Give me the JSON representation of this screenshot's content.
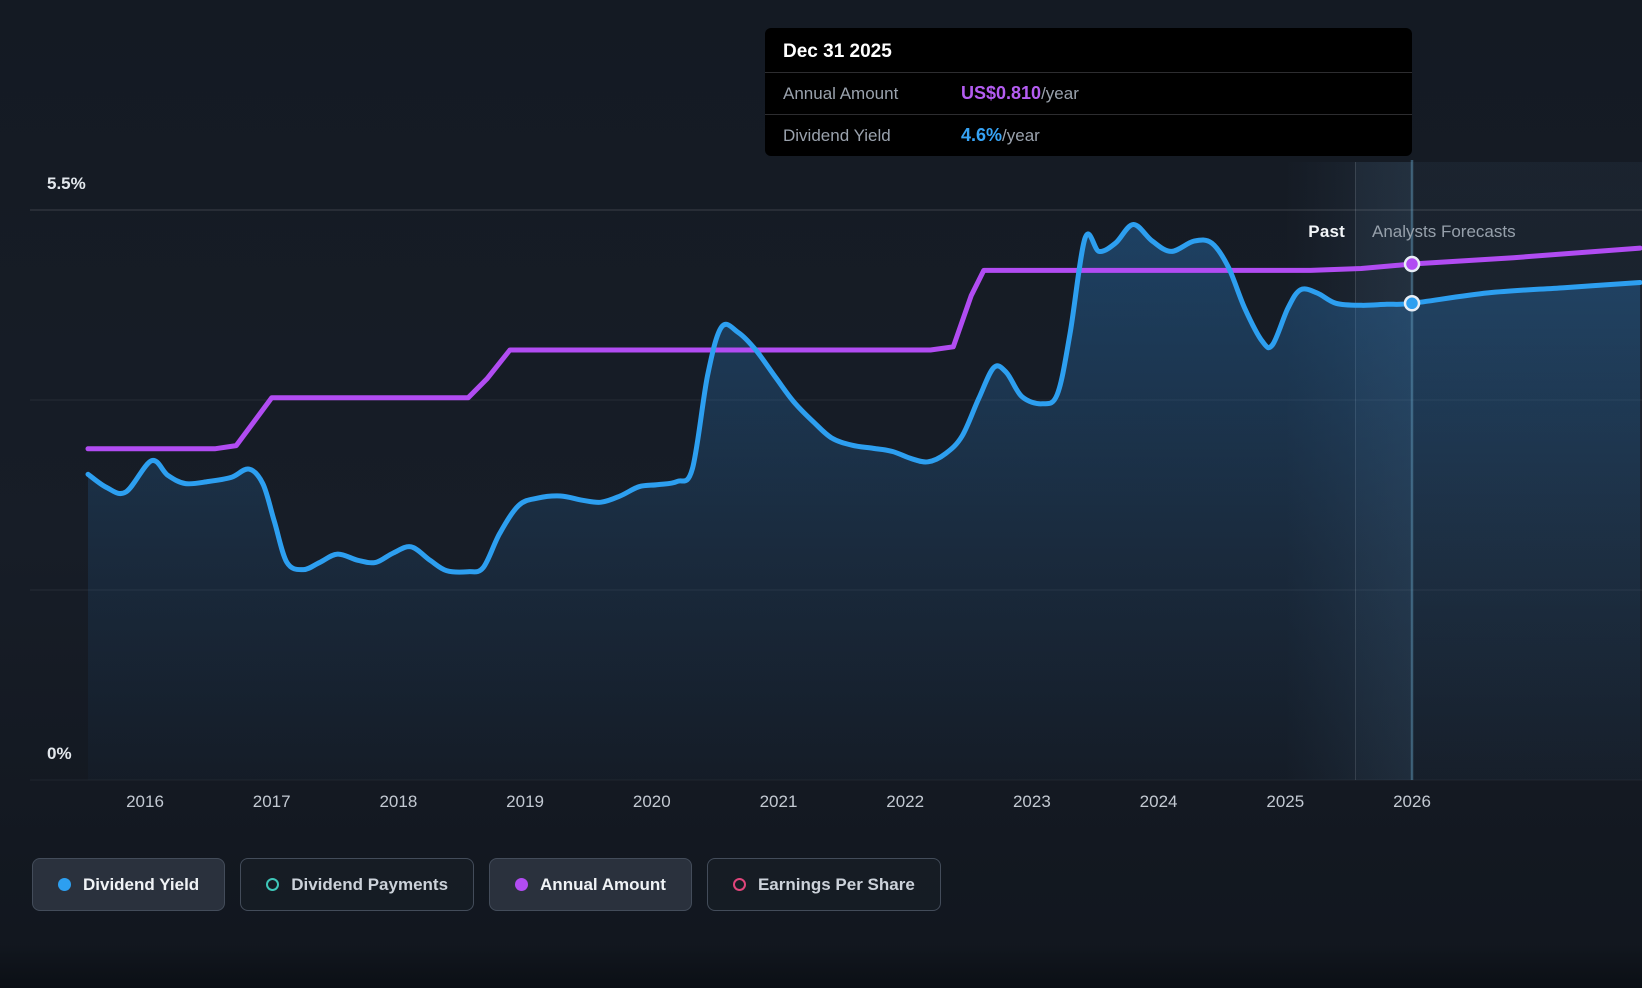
{
  "tooltip": {
    "date": "Dec 31 2025",
    "rows": [
      {
        "label": "Annual Amount",
        "value": "US$0.810",
        "suffix": "/year",
        "color": "#b45df2"
      },
      {
        "label": "Dividend Yield",
        "value": "4.6%",
        "suffix": "/year",
        "color": "#36a3f5"
      }
    ]
  },
  "axis": {
    "y_top_label": "5.5%",
    "y_bottom_label": "0%",
    "x_labels": [
      "2016",
      "2017",
      "2018",
      "2019",
      "2020",
      "2021",
      "2022",
      "2023",
      "2024",
      "2025",
      "2026"
    ]
  },
  "regions": {
    "past_label": "Past",
    "forecast_label": "Analysts Forecasts"
  },
  "legend": [
    {
      "label": "Dividend Yield",
      "marker": "filled",
      "color": "#2d9ff0",
      "active": true
    },
    {
      "label": "Dividend Payments",
      "marker": "ring",
      "color": "#3ec6b8",
      "active": false
    },
    {
      "label": "Annual Amount",
      "marker": "filled",
      "color": "#b14cf2",
      "active": true
    },
    {
      "label": "Earnings Per Share",
      "marker": "ring",
      "color": "#e0457b",
      "active": false
    }
  ],
  "chart_data": {
    "type": "line",
    "x_ticks": [
      2016,
      2017,
      2018,
      2019,
      2020,
      2021,
      2022,
      2023,
      2024,
      2025,
      2026
    ],
    "y_axis": {
      "unit": "%",
      "min": 0,
      "max": 5.5,
      "labels_shown": [
        "5.5%",
        "0%"
      ],
      "grid": true
    },
    "secondary_y_axis": {
      "unit": "US$/year",
      "used_by": "Annual Amount"
    },
    "past_until_x": 2025.55,
    "hover": {
      "x": 2026.0,
      "date": "Dec 31 2025",
      "annual_amount": 0.81,
      "dividend_yield_pct": 4.6
    },
    "series": [
      {
        "name": "Dividend Yield",
        "color": "#2d9ff0",
        "unit": "%",
        "axis": "percent",
        "style": "smooth-area",
        "points": [
          [
            2015.55,
            2.95
          ],
          [
            2015.7,
            2.82
          ],
          [
            2015.85,
            2.78
          ],
          [
            2016.05,
            3.08
          ],
          [
            2016.18,
            2.94
          ],
          [
            2016.32,
            2.86
          ],
          [
            2016.5,
            2.88
          ],
          [
            2016.68,
            2.92
          ],
          [
            2016.82,
            3.0
          ],
          [
            2016.93,
            2.86
          ],
          [
            2017.02,
            2.5
          ],
          [
            2017.12,
            2.1
          ],
          [
            2017.25,
            2.03
          ],
          [
            2017.38,
            2.1
          ],
          [
            2017.52,
            2.18
          ],
          [
            2017.68,
            2.12
          ],
          [
            2017.82,
            2.1
          ],
          [
            2017.96,
            2.19
          ],
          [
            2018.1,
            2.25
          ],
          [
            2018.25,
            2.12
          ],
          [
            2018.38,
            2.02
          ],
          [
            2018.55,
            2.01
          ],
          [
            2018.67,
            2.05
          ],
          [
            2018.8,
            2.38
          ],
          [
            2018.95,
            2.65
          ],
          [
            2019.1,
            2.72
          ],
          [
            2019.28,
            2.74
          ],
          [
            2019.45,
            2.7
          ],
          [
            2019.6,
            2.68
          ],
          [
            2019.75,
            2.74
          ],
          [
            2019.9,
            2.83
          ],
          [
            2020.05,
            2.85
          ],
          [
            2020.2,
            2.88
          ],
          [
            2020.32,
            3.0
          ],
          [
            2020.44,
            3.9
          ],
          [
            2020.55,
            4.37
          ],
          [
            2020.68,
            4.32
          ],
          [
            2020.82,
            4.15
          ],
          [
            2020.98,
            3.88
          ],
          [
            2021.12,
            3.65
          ],
          [
            2021.28,
            3.45
          ],
          [
            2021.42,
            3.3
          ],
          [
            2021.58,
            3.23
          ],
          [
            2021.75,
            3.2
          ],
          [
            2021.9,
            3.17
          ],
          [
            2022.05,
            3.1
          ],
          [
            2022.18,
            3.07
          ],
          [
            2022.32,
            3.15
          ],
          [
            2022.45,
            3.32
          ],
          [
            2022.58,
            3.68
          ],
          [
            2022.7,
            3.98
          ],
          [
            2022.8,
            3.93
          ],
          [
            2022.92,
            3.7
          ],
          [
            2023.08,
            3.63
          ],
          [
            2023.2,
            3.72
          ],
          [
            2023.3,
            4.3
          ],
          [
            2023.42,
            5.23
          ],
          [
            2023.53,
            5.1
          ],
          [
            2023.66,
            5.18
          ],
          [
            2023.8,
            5.36
          ],
          [
            2023.95,
            5.2
          ],
          [
            2024.1,
            5.1
          ],
          [
            2024.28,
            5.2
          ],
          [
            2024.42,
            5.18
          ],
          [
            2024.55,
            4.95
          ],
          [
            2024.68,
            4.55
          ],
          [
            2024.82,
            4.23
          ],
          [
            2024.9,
            4.2
          ],
          [
            2025.02,
            4.55
          ],
          [
            2025.12,
            4.73
          ],
          [
            2025.25,
            4.7
          ],
          [
            2025.4,
            4.6
          ],
          [
            2025.6,
            4.58
          ],
          [
            2025.8,
            4.59
          ],
          [
            2026.0,
            4.6
          ],
          [
            2026.6,
            4.7
          ],
          [
            2027.2,
            4.75
          ],
          [
            2027.8,
            4.8
          ]
        ]
      },
      {
        "name": "Annual Amount",
        "color": "#b14cf2",
        "unit": "US$/year",
        "axis": "amount",
        "style": "step",
        "points": [
          [
            2015.55,
            0.52
          ],
          [
            2016.55,
            0.52
          ],
          [
            2016.72,
            0.525
          ],
          [
            2017.0,
            0.6
          ],
          [
            2017.5,
            0.6
          ],
          [
            2018.0,
            0.6
          ],
          [
            2018.55,
            0.6
          ],
          [
            2018.7,
            0.63
          ],
          [
            2018.88,
            0.675
          ],
          [
            2019.5,
            0.675
          ],
          [
            2020.5,
            0.675
          ],
          [
            2021.5,
            0.675
          ],
          [
            2022.2,
            0.675
          ],
          [
            2022.38,
            0.68
          ],
          [
            2022.52,
            0.76
          ],
          [
            2022.62,
            0.8
          ],
          [
            2023.5,
            0.8
          ],
          [
            2024.5,
            0.8
          ],
          [
            2025.2,
            0.8
          ],
          [
            2025.6,
            0.803
          ],
          [
            2026.0,
            0.81
          ],
          [
            2026.8,
            0.82
          ],
          [
            2027.8,
            0.835
          ]
        ]
      }
    ]
  }
}
